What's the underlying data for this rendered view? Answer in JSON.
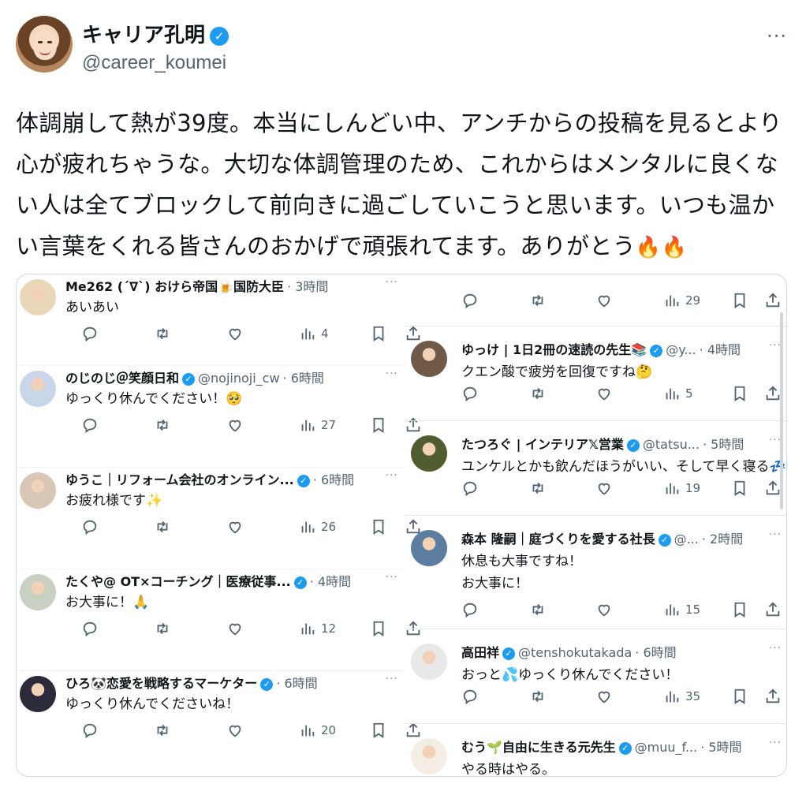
{
  "post": {
    "display_name": "キャリア孔明",
    "handle": "@career_koumei",
    "text": "体調崩して熱が39度。本当にしんどい中、アンチからの投稿を見るとより心が疲れちゃうな。大切な体調管理のため、これからはメンタルに良くない人は全てブロックして前向きに過ごしていこうと思います。いつも温かい言葉をくれる皆さんのおかげで頑張れてます。ありがとう",
    "emoji_suffix": "🔥🔥",
    "more": "···"
  },
  "left_replies": [
    {
      "name": "Me262 (´∇`) おけら帝国🍺国防大臣",
      "handle": "",
      "time": "· 3時間",
      "text": "あいあい",
      "views": "4",
      "verified": false
    },
    {
      "name": "のじのじ＠笑顔日和",
      "handle": "@nojinoji_cw",
      "time": "· 6時間",
      "text": "ゆっくり休んでください！🥺",
      "views": "27",
      "verified": true
    },
    {
      "name": "ゆうこ｜リフォーム会社のオンライン...",
      "handle": "",
      "time": "· 6時間",
      "text": "お疲れ様です✨",
      "views": "26",
      "verified": true
    },
    {
      "name": "たくや@ OT×コーチング｜医療従事...",
      "handle": "",
      "time": "· 4時間",
      "text": "お大事に！🙏",
      "views": "12",
      "verified": true
    },
    {
      "name": "ひろ🐼恋愛を戦略するマーケター",
      "handle": "",
      "time": "· 6時間",
      "text": "ゆっくり休んでくださいね！",
      "views": "20",
      "verified": true
    }
  ],
  "right_replies": [
    {
      "name": "ゆっけ | 1日2冊の速読の先生📚",
      "handle": "@y...",
      "time": "· 4時間",
      "text": "クエン酸で疲労を回復ですね🤔",
      "text2": "",
      "views": "5",
      "verified": true
    },
    {
      "name": "たつろぐ | インテリア𝕏営業",
      "handle": "@tatsu...",
      "time": "· 5時間",
      "text": "ユンケルとかも飲んだほうがいい、そして早く寝る💤",
      "text2": "",
      "views": "19",
      "verified": true
    },
    {
      "name": "森本 隆嗣｜庭づくりを愛する社長",
      "handle": "@...",
      "time": "· 2時間",
      "text": "休息も大事ですね！",
      "text2": "お大事に！",
      "views": "15",
      "verified": true
    },
    {
      "name": "高田祥",
      "handle": "@tenshokutakada",
      "time": "· 6時間",
      "text": "おっと💦ゆっくり休んでください！",
      "text2": "",
      "views": "35",
      "verified": true
    },
    {
      "name": "むう🌱自由に生きる元先生",
      "handle": "@muu_f...",
      "time": "· 5時間",
      "text": "やる時はやる。",
      "text2": "",
      "views": "",
      "verified": true
    }
  ],
  "right_top_views": "29",
  "colors": {
    "accent": "#1d9bf0",
    "muted": "#536471",
    "text": "#0f1419",
    "border": "#cfd9de"
  }
}
